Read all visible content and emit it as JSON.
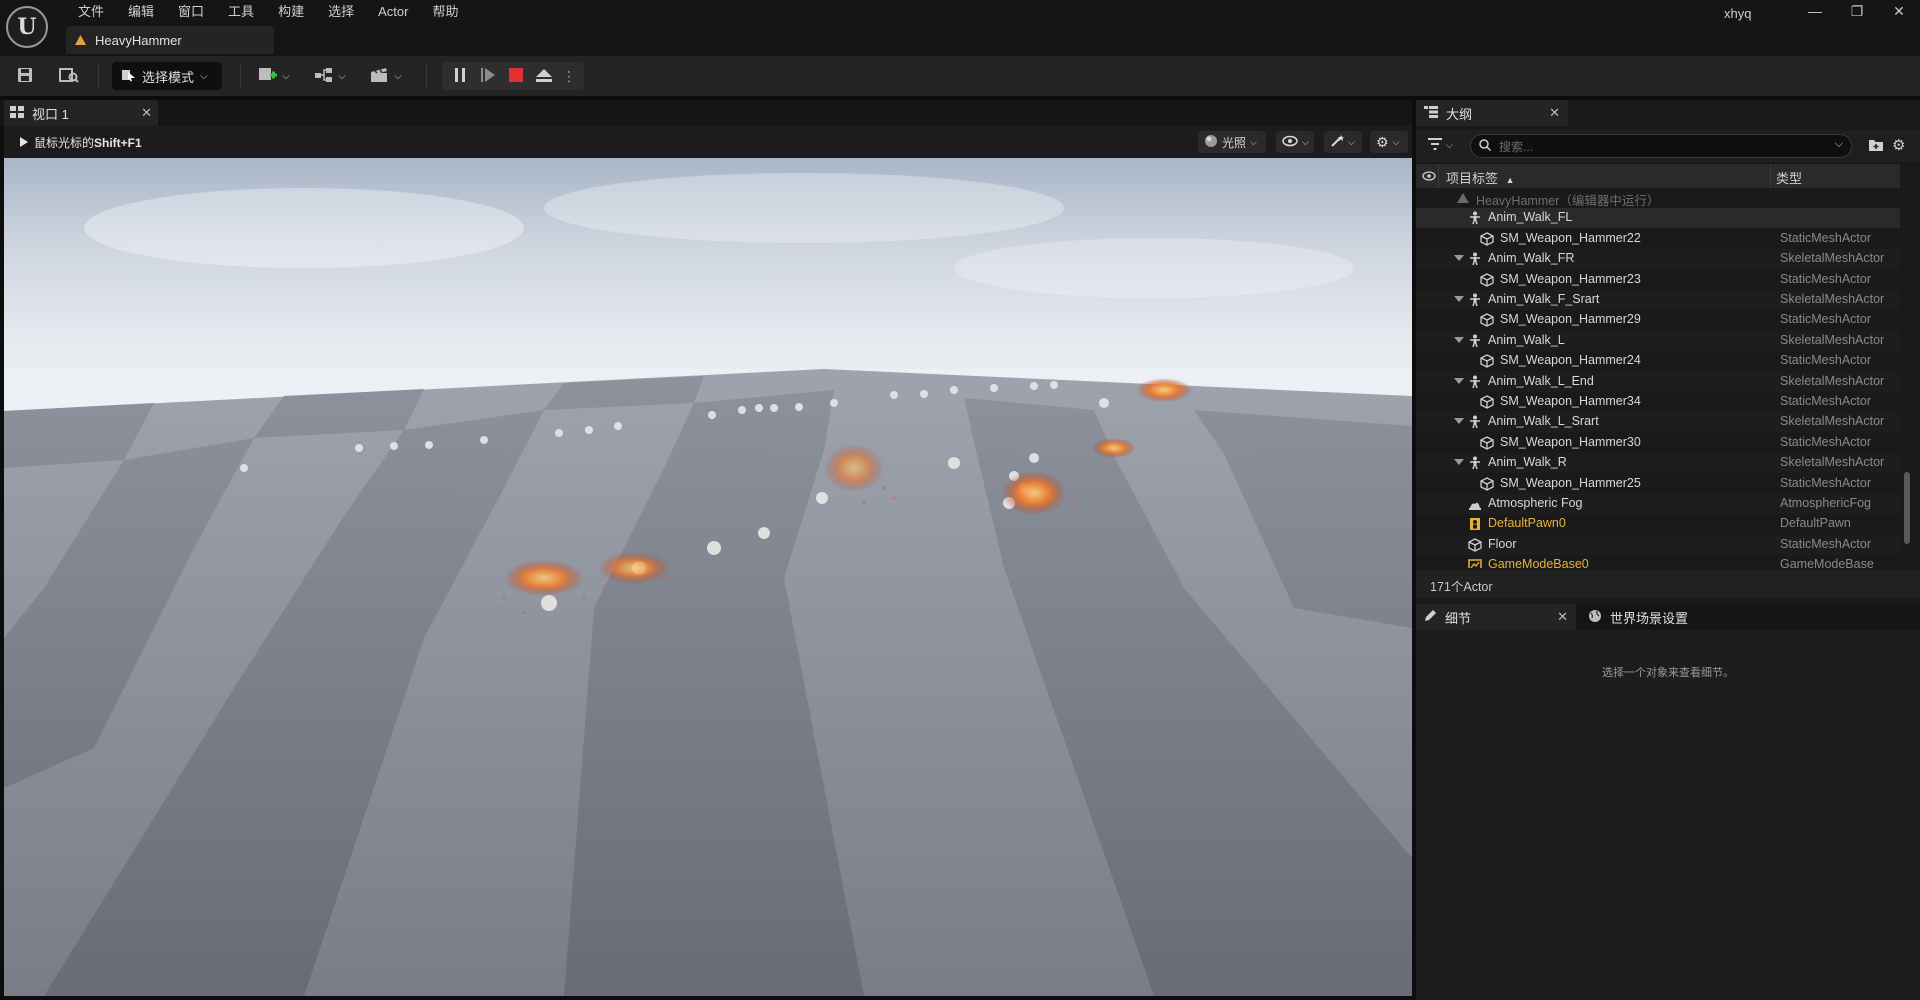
{
  "menu": [
    "文件",
    "编辑",
    "窗口",
    "工具",
    "构建",
    "选择",
    "Actor",
    "帮助"
  ],
  "logo_text": "U",
  "level_tab": "HeavyHammer",
  "user": "xhyq",
  "window_controls": {
    "minimize": "—",
    "restore": "❐",
    "close": "✕"
  },
  "toolbar": {
    "mode_label": "选择模式"
  },
  "viewport": {
    "tab_label": "视口 1",
    "hint_prefix": "鼠标光标的",
    "hint_key": "Shift+F1",
    "lighting_label": "光照"
  },
  "outliner": {
    "tab_label": "大纲",
    "search_placeholder": "搜索...",
    "col_label": "项目标签",
    "col_type": "类型",
    "rows": [
      {
        "label": "HeavyHammer（编辑器中运行）",
        "type": "",
        "depth": 0,
        "expand": false,
        "icon": "level",
        "dim": true,
        "yellow": false
      },
      {
        "label": "Anim_Walk_FL",
        "type": "",
        "depth": 1,
        "expand": false,
        "icon": "skeletal",
        "dim": false,
        "yellow": false,
        "selected": true
      },
      {
        "label": "SM_Weapon_Hammer22",
        "type": "StaticMeshActor",
        "depth": 2,
        "expand": false,
        "icon": "mesh",
        "dim": false,
        "yellow": false
      },
      {
        "label": "Anim_Walk_FR",
        "type": "SkeletalMeshActor",
        "depth": 1,
        "expand": true,
        "icon": "skeletal",
        "dim": false,
        "yellow": false
      },
      {
        "label": "SM_Weapon_Hammer23",
        "type": "StaticMeshActor",
        "depth": 2,
        "expand": false,
        "icon": "mesh",
        "dim": false,
        "yellow": false
      },
      {
        "label": "Anim_Walk_F_Srart",
        "type": "SkeletalMeshActor",
        "depth": 1,
        "expand": true,
        "icon": "skeletal",
        "dim": false,
        "yellow": false
      },
      {
        "label": "SM_Weapon_Hammer29",
        "type": "StaticMeshActor",
        "depth": 2,
        "expand": false,
        "icon": "mesh",
        "dim": false,
        "yellow": false
      },
      {
        "label": "Anim_Walk_L",
        "type": "SkeletalMeshActor",
        "depth": 1,
        "expand": true,
        "icon": "skeletal",
        "dim": false,
        "yellow": false
      },
      {
        "label": "SM_Weapon_Hammer24",
        "type": "StaticMeshActor",
        "depth": 2,
        "expand": false,
        "icon": "mesh",
        "dim": false,
        "yellow": false
      },
      {
        "label": "Anim_Walk_L_End",
        "type": "SkeletalMeshActor",
        "depth": 1,
        "expand": true,
        "icon": "skeletal",
        "dim": false,
        "yellow": false
      },
      {
        "label": "SM_Weapon_Hammer34",
        "type": "StaticMeshActor",
        "depth": 2,
        "expand": false,
        "icon": "mesh",
        "dim": false,
        "yellow": false
      },
      {
        "label": "Anim_Walk_L_Srart",
        "type": "SkeletalMeshActor",
        "depth": 1,
        "expand": true,
        "icon": "skeletal",
        "dim": false,
        "yellow": false
      },
      {
        "label": "SM_Weapon_Hammer30",
        "type": "StaticMeshActor",
        "depth": 2,
        "expand": false,
        "icon": "mesh",
        "dim": false,
        "yellow": false
      },
      {
        "label": "Anim_Walk_R",
        "type": "SkeletalMeshActor",
        "depth": 1,
        "expand": true,
        "icon": "skeletal",
        "dim": false,
        "yellow": false
      },
      {
        "label": "SM_Weapon_Hammer25",
        "type": "StaticMeshActor",
        "depth": 2,
        "expand": false,
        "icon": "mesh",
        "dim": false,
        "yellow": false
      },
      {
        "label": "Atmospheric Fog",
        "type": "AtmosphericFog",
        "depth": 1,
        "expand": false,
        "icon": "fog",
        "dim": false,
        "yellow": false
      },
      {
        "label": "DefaultPawn0",
        "type": "DefaultPawn",
        "depth": 1,
        "expand": false,
        "icon": "pawn",
        "dim": false,
        "yellow": true
      },
      {
        "label": "Floor",
        "type": "StaticMeshActor",
        "depth": 1,
        "expand": false,
        "icon": "mesh",
        "dim": false,
        "yellow": false
      },
      {
        "label": "GameModeBase0",
        "type": "GameModeBase",
        "depth": 1,
        "expand": false,
        "icon": "gamemode",
        "dim": false,
        "yellow": true
      }
    ],
    "footer": "171个Actor"
  },
  "details": {
    "tab_label": "细节",
    "world_tab_label": "世界场景设置",
    "empty_text": "选择一个对象来查看细节。"
  },
  "colors": {
    "accent_yellow": "#e8b23a",
    "stop_red": "#e03030",
    "sky_top": "#b8c4d4",
    "floor": "#8e93a0"
  }
}
